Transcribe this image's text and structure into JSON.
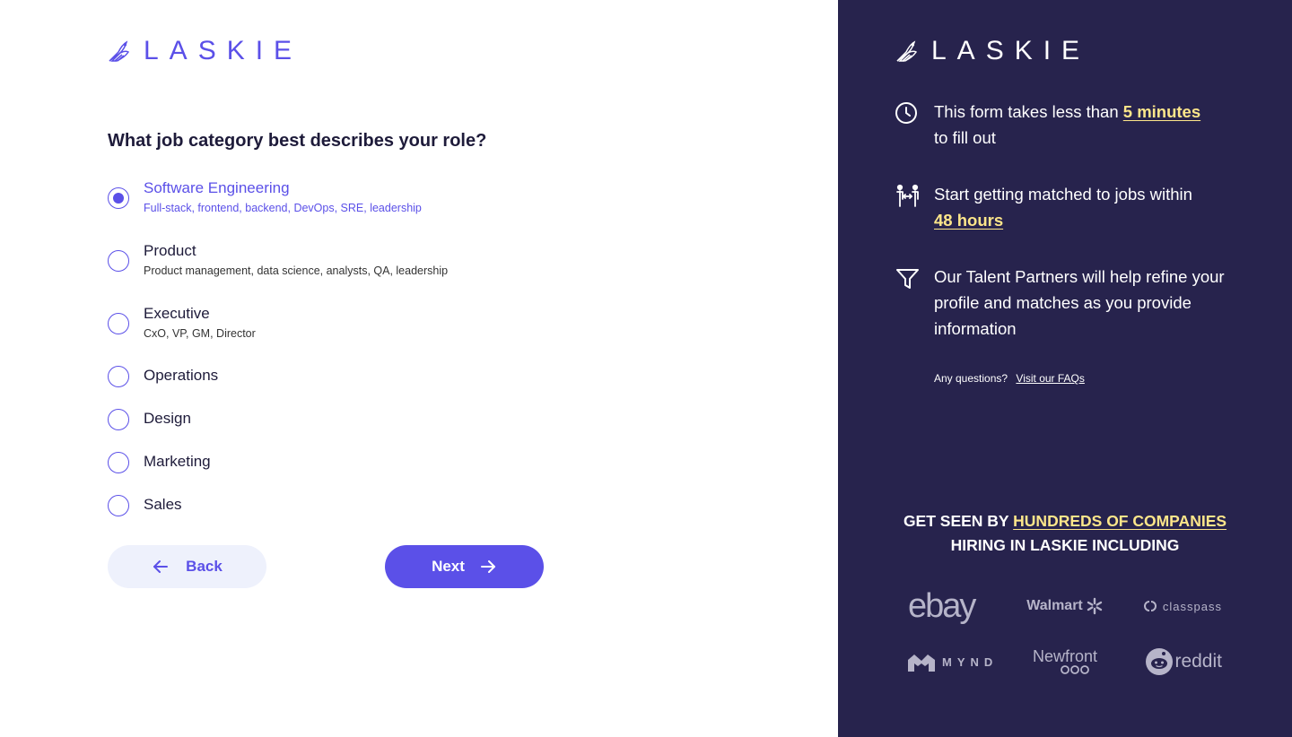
{
  "brand": {
    "name": "LASKIE",
    "accent": "#5b50e8",
    "panel_bg": "#27234d",
    "highlight": "#fde68a"
  },
  "form": {
    "question": "What job category best describes your role?",
    "options": [
      {
        "label": "Software Engineering",
        "sub": "Full-stack, frontend, backend, DevOps, SRE, leadership",
        "selected": true
      },
      {
        "label": "Product",
        "sub": "Product management, data science, analysts, QA, leadership",
        "selected": false
      },
      {
        "label": "Executive",
        "sub": "CxO, VP, GM, Director",
        "selected": false
      },
      {
        "label": "Operations",
        "sub": "",
        "selected": false
      },
      {
        "label": "Design",
        "sub": "",
        "selected": false
      },
      {
        "label": "Marketing",
        "sub": "",
        "selected": false
      },
      {
        "label": "Sales",
        "sub": "",
        "selected": false
      }
    ],
    "back_label": "Back",
    "next_label": "Next"
  },
  "sidebar": {
    "features": [
      {
        "icon": "clock-icon",
        "text_before": "This form takes less than ",
        "highlight": "5 minutes",
        "text_after": " to fill out"
      },
      {
        "icon": "people-match-icon",
        "text_before": "Start getting matched to jobs within ",
        "highlight": "48 hours",
        "text_after": ""
      },
      {
        "icon": "filter-icon",
        "text_before": "Our Talent Partners will help refine your profile and matches as you provide information",
        "highlight": "",
        "text_after": ""
      }
    ],
    "questions_text": "Any questions?",
    "faq_link": "Visit our FAQs",
    "seen_before": "GET SEEN BY ",
    "seen_highlight": "HUNDREDS OF COMPANIES",
    "seen_after": "HIRING IN LASKIE INCLUDING",
    "companies": [
      "ebay",
      "Walmart",
      "classpass",
      "MYND",
      "Newfront",
      "reddit"
    ]
  }
}
